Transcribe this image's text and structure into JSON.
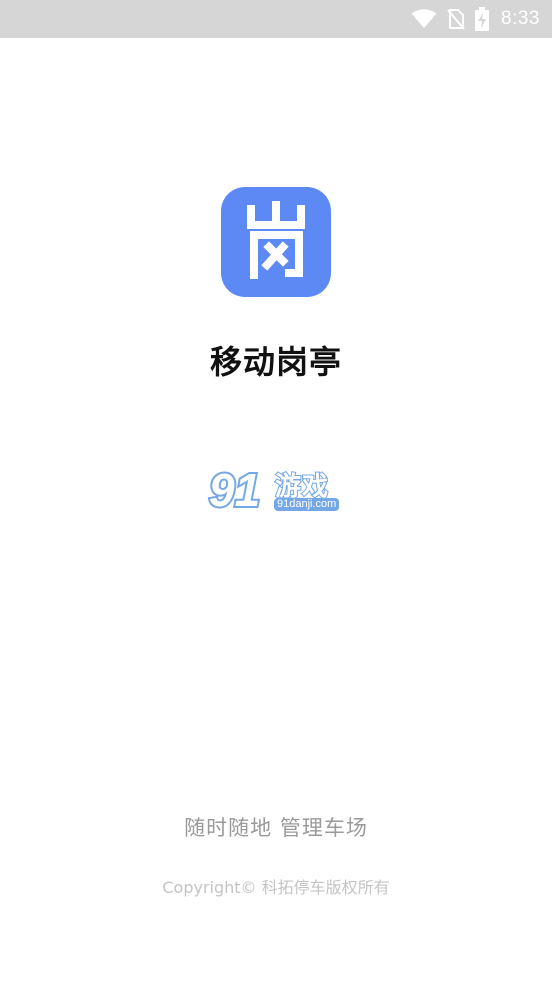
{
  "status_bar": {
    "time": "8:33",
    "icons": [
      "wifi-icon",
      "no-sim-icon",
      "battery-charging-icon"
    ]
  },
  "splash": {
    "app_icon_glyph": "岗",
    "app_icon_color": "#5d89f5",
    "app_name": "移动岗亭",
    "partner_logo": {
      "number": "91",
      "brand": "游戏",
      "domain": "91danji.com",
      "color": "#74a7e6"
    },
    "slogan": "随时随地 管理车场",
    "copyright": "Copyright© 科拓停车版权所有"
  }
}
